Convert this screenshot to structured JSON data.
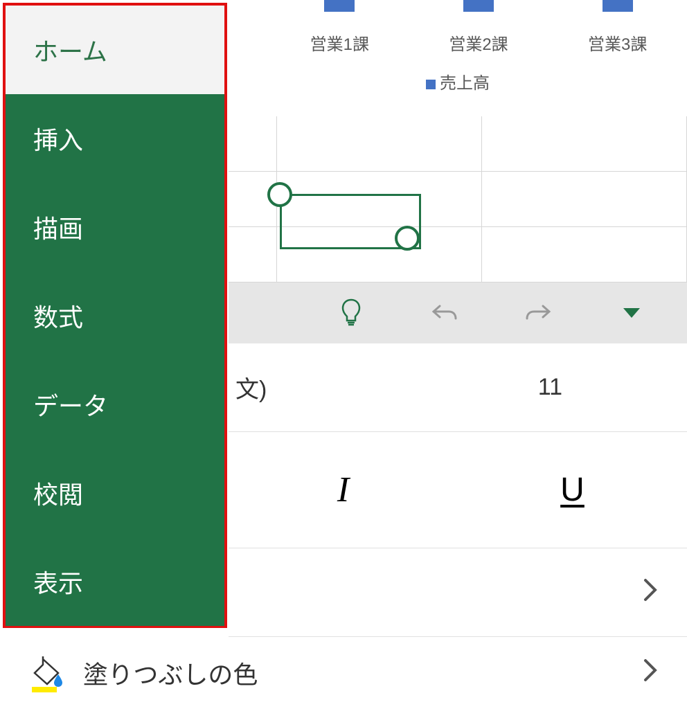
{
  "tabs": {
    "home": "ホーム",
    "insert": "挿入",
    "draw": "描画",
    "formulas": "数式",
    "data": "データ",
    "review": "校閲",
    "view": "表示"
  },
  "chart": {
    "legend_label": "売上高",
    "categories": [
      "営業1課",
      "営業2課",
      "営業3課"
    ]
  },
  "font": {
    "name_suffix": "文)",
    "size": "11"
  },
  "format": {
    "italic": "I",
    "underline": "U"
  },
  "fill": {
    "label": "塗りつぶしの色"
  },
  "chart_data": {
    "type": "bar",
    "categories": [
      "営業1課",
      "営業2課",
      "営業3課"
    ],
    "series": [
      {
        "name": "売上高",
        "values": null
      }
    ],
    "note": "Only partial bars visible at top edge; values not readable"
  }
}
